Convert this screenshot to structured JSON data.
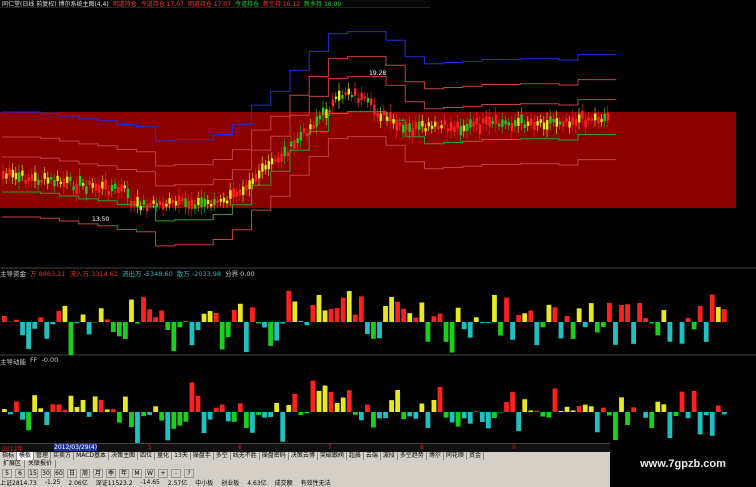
{
  "colors": {
    "red_band": "#8b0000",
    "up": "#ff2020",
    "down": "#20c0c0",
    "green": "#18d018",
    "yellow": "#e8e820",
    "blue_line": "#2a2ad8",
    "line_red": "#c84040",
    "line_green": "#30a030",
    "axis_text": "#cc2020"
  },
  "header": {
    "stock_label": "同仁堂(日线 前复权) 博尔系统主图(4,4)",
    "tags": [
      "明道持仓",
      "今道持仓 17.07",
      "明道持仓 17.07",
      "今道持仓"
    ],
    "tag_right_1": "新空持 16.12",
    "tag_right_2": "新多持 16.09"
  },
  "annotations": {
    "high_price": "19.28",
    "low_price": "13.50"
  },
  "indicator1": {
    "name": "主导资金",
    "items": [
      {
        "label": "万",
        "value": "8863.21",
        "color": "#e03030"
      },
      {
        "label": "流入万",
        "value": "3314.62",
        "color": "#e03030"
      },
      {
        "label": "流出万",
        "value": "-5348.60",
        "color": "#20c0c0"
      },
      {
        "label": "散万",
        "value": "-2033.98",
        "color": "#20c0c0"
      },
      {
        "label": "分界",
        "value": "0.00",
        "color": "#cfcfcf"
      }
    ]
  },
  "indicator2": {
    "name": "主导动能",
    "label": "FF",
    "value": "-0.00"
  },
  "axis": {
    "year": "2012年",
    "range": "2012/03/29(4)",
    "ticks": [
      "5",
      "6",
      "7",
      "8",
      "9"
    ]
  },
  "tabs_row1": [
    "指标",
    "模板",
    "管理",
    "买卖方",
    "MACD基本",
    "决策主图",
    "四位",
    "量化",
    "13天",
    "操盘手",
    "多空",
    "线无不胜",
    "操盘密码",
    "决策云博",
    "突破跟阀",
    "超晨",
    "云端",
    "波段",
    "多空趋势",
    "博尔",
    "同花顺",
    "资金"
  ],
  "tabs_row2": [
    "扩展区",
    "关联报价"
  ],
  "toolbar_icons": [
    "5",
    "6",
    "15",
    "30",
    "60",
    "日",
    "周",
    "月",
    "季",
    "年",
    "M",
    "W",
    "+",
    "-",
    "?"
  ],
  "status_items": [
    "上证2814.73",
    "-1.25",
    "2.06亿",
    "深证11523.2",
    "-14.65",
    "2.57亿",
    "中小板",
    "创业板",
    "4.63亿",
    "成交额",
    "有效性无法"
  ],
  "watermark": "www.7gpzb.com",
  "chart_data": [
    {
      "type": "candlestick",
      "title": "博尔系统主图",
      "annotations": [
        {
          "label": "19.28",
          "kind": "high"
        },
        {
          "label": "13.50",
          "kind": "low"
        }
      ],
      "x_axis": [
        "2012年",
        "5",
        "6",
        "7",
        "8",
        "9"
      ]
    },
    {
      "type": "bar",
      "title": "主导资金",
      "series": [
        {
          "name": "万"
        },
        {
          "name": "流入万"
        },
        {
          "name": "流出万"
        },
        {
          "name": "散万"
        }
      ],
      "baseline": 0
    },
    {
      "type": "bar",
      "title": "主导动能",
      "series": [
        {
          "name": "FF"
        }
      ],
      "baseline": 0
    }
  ]
}
